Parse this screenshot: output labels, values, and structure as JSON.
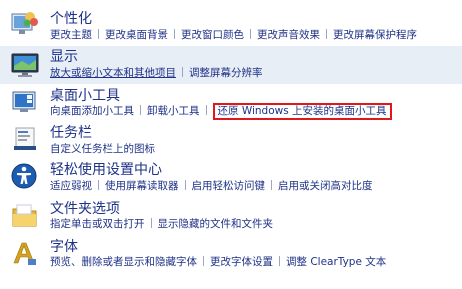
{
  "items": [
    {
      "title": "个性化",
      "links": [
        "更改主题",
        "更改桌面背景",
        "更改窗口颜色",
        "更改声音效果",
        "更改屏幕保护程序"
      ],
      "icon": "personalization-icon"
    },
    {
      "title": "显示",
      "links": [
        "放大或缩小文本和其他项目",
        "调整屏幕分辨率"
      ],
      "icon": "display-icon"
    },
    {
      "title": "桌面小工具",
      "links": [
        "向桌面添加小工具",
        "卸载小工具",
        "还原 Windows 上安装的桌面小工具"
      ],
      "icon": "gadgets-icon"
    },
    {
      "title": "任务栏",
      "links": [
        "自定义任务栏上的图标"
      ],
      "icon": "taskbar-icon"
    },
    {
      "title": "轻松使用设置中心",
      "links": [
        "适应弱视",
        "使用屏幕读取器",
        "启用轻松访问键",
        "启用或关闭高对比度"
      ],
      "icon": "ease-of-access-icon"
    },
    {
      "title": "文件夹选项",
      "links": [
        "指定单击或双击打开",
        "显示隐藏的文件和文件夹"
      ],
      "icon": "folder-options-icon"
    },
    {
      "title": "字体",
      "links": [
        "预览、删除或者显示和隐藏字体",
        "更改字体设置",
        "调整 ClearType 文本"
      ],
      "icon": "fonts-icon"
    }
  ]
}
